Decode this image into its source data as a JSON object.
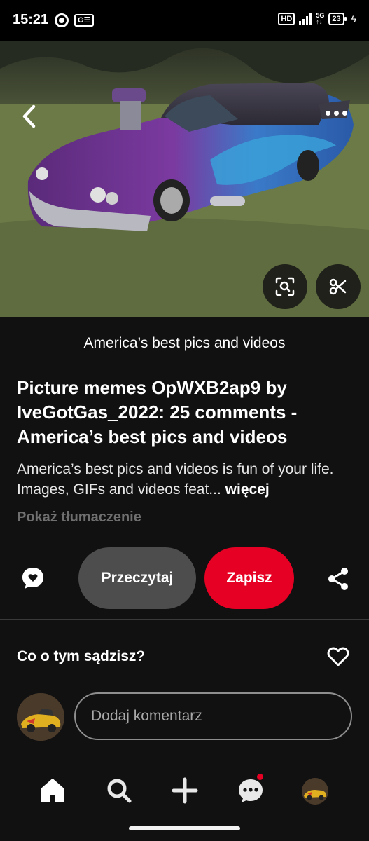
{
  "status_bar": {
    "time": "15:21",
    "hd_label": "HD",
    "network_label_top": "5G",
    "network_label_bottom": "↑↓",
    "battery_level": "23",
    "icons": [
      "chrome-icon",
      "ge-notification-icon",
      "signal-icon",
      "battery-icon",
      "charging-bolt-icon"
    ]
  },
  "hero": {
    "back_icon": "chevron-left-icon",
    "more_icon": "more-horizontal-icon",
    "lens_icon": "visual-search-icon",
    "cut_icon": "scissors-icon"
  },
  "pin": {
    "source": "America’s best pics and videos",
    "title": "Picture memes OpWXB2ap9 by IveGotGas_2022: 25 comments - America’s best pics and videos",
    "description": "America’s best pics and videos is fun of your life. Images, GIFs and videos feat...",
    "more_label": "więcej",
    "translate_label": "Pokaż tłumaczenie"
  },
  "actions": {
    "comment_icon": "comment-bubble-icon",
    "read_label": "Przeczytaj",
    "save_label": "Zapisz",
    "share_icon": "share-icon",
    "save_color": "#e60023"
  },
  "feedback": {
    "prompt": "Co o tym sądzisz?",
    "heart_icon": "heart-outline-icon",
    "comment_placeholder": "Dodaj komentarz"
  },
  "bottom_nav": {
    "items": [
      "home-icon",
      "search-icon",
      "plus-icon",
      "messages-icon",
      "profile-avatar"
    ],
    "active": "home-icon",
    "messages_has_notification": true
  }
}
